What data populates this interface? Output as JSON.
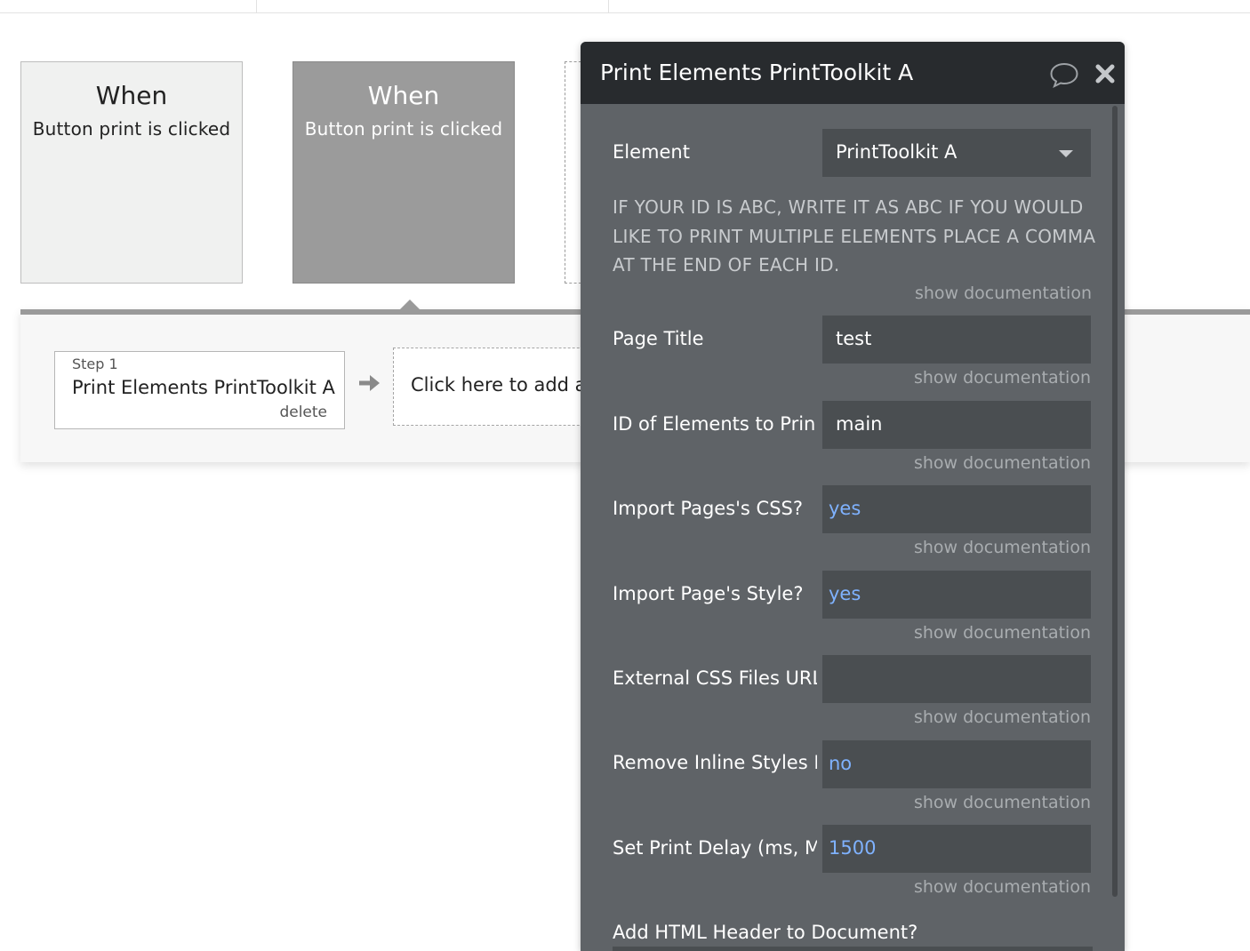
{
  "events": [
    {
      "when": "When",
      "description": "Button print is clicked"
    },
    {
      "when": "When",
      "description": "Button print is clicked"
    }
  ],
  "workflow": {
    "step": {
      "label": "Step 1",
      "name": "Print Elements PrintToolkit A",
      "delete": "delete"
    },
    "add_action": "Click here to add ar"
  },
  "editor": {
    "title": "Print Elements PrintToolkit A",
    "element_label": "Element",
    "element_value": "PrintToolkit A",
    "note": "IF YOUR ID IS ABC, WRITE IT AS ABC IF YOU WOULD LIKE TO PRINT MULTIPLE ELEMENTS PLACE A COMMA AT THE END OF EACH ID.",
    "doc_link": "show documentation",
    "fields": [
      {
        "label": "Page Title",
        "value": "test",
        "dynamic": false
      },
      {
        "label": "ID of Elements to Prin",
        "value": "main",
        "dynamic": false
      },
      {
        "label": "Import Pages's CSS?",
        "value": "yes",
        "dynamic": true
      },
      {
        "label": "Import Page's Style?",
        "value": "yes",
        "dynamic": true
      },
      {
        "label": "External CSS Files URL",
        "value": "",
        "dynamic": false
      },
      {
        "label": "Remove Inline Styles F",
        "value": "no",
        "dynamic": true
      },
      {
        "label": "Set Print Delay (ms, M",
        "value": "1500",
        "dynamic": true
      }
    ],
    "last_label": "Add HTML Header to Document?"
  }
}
